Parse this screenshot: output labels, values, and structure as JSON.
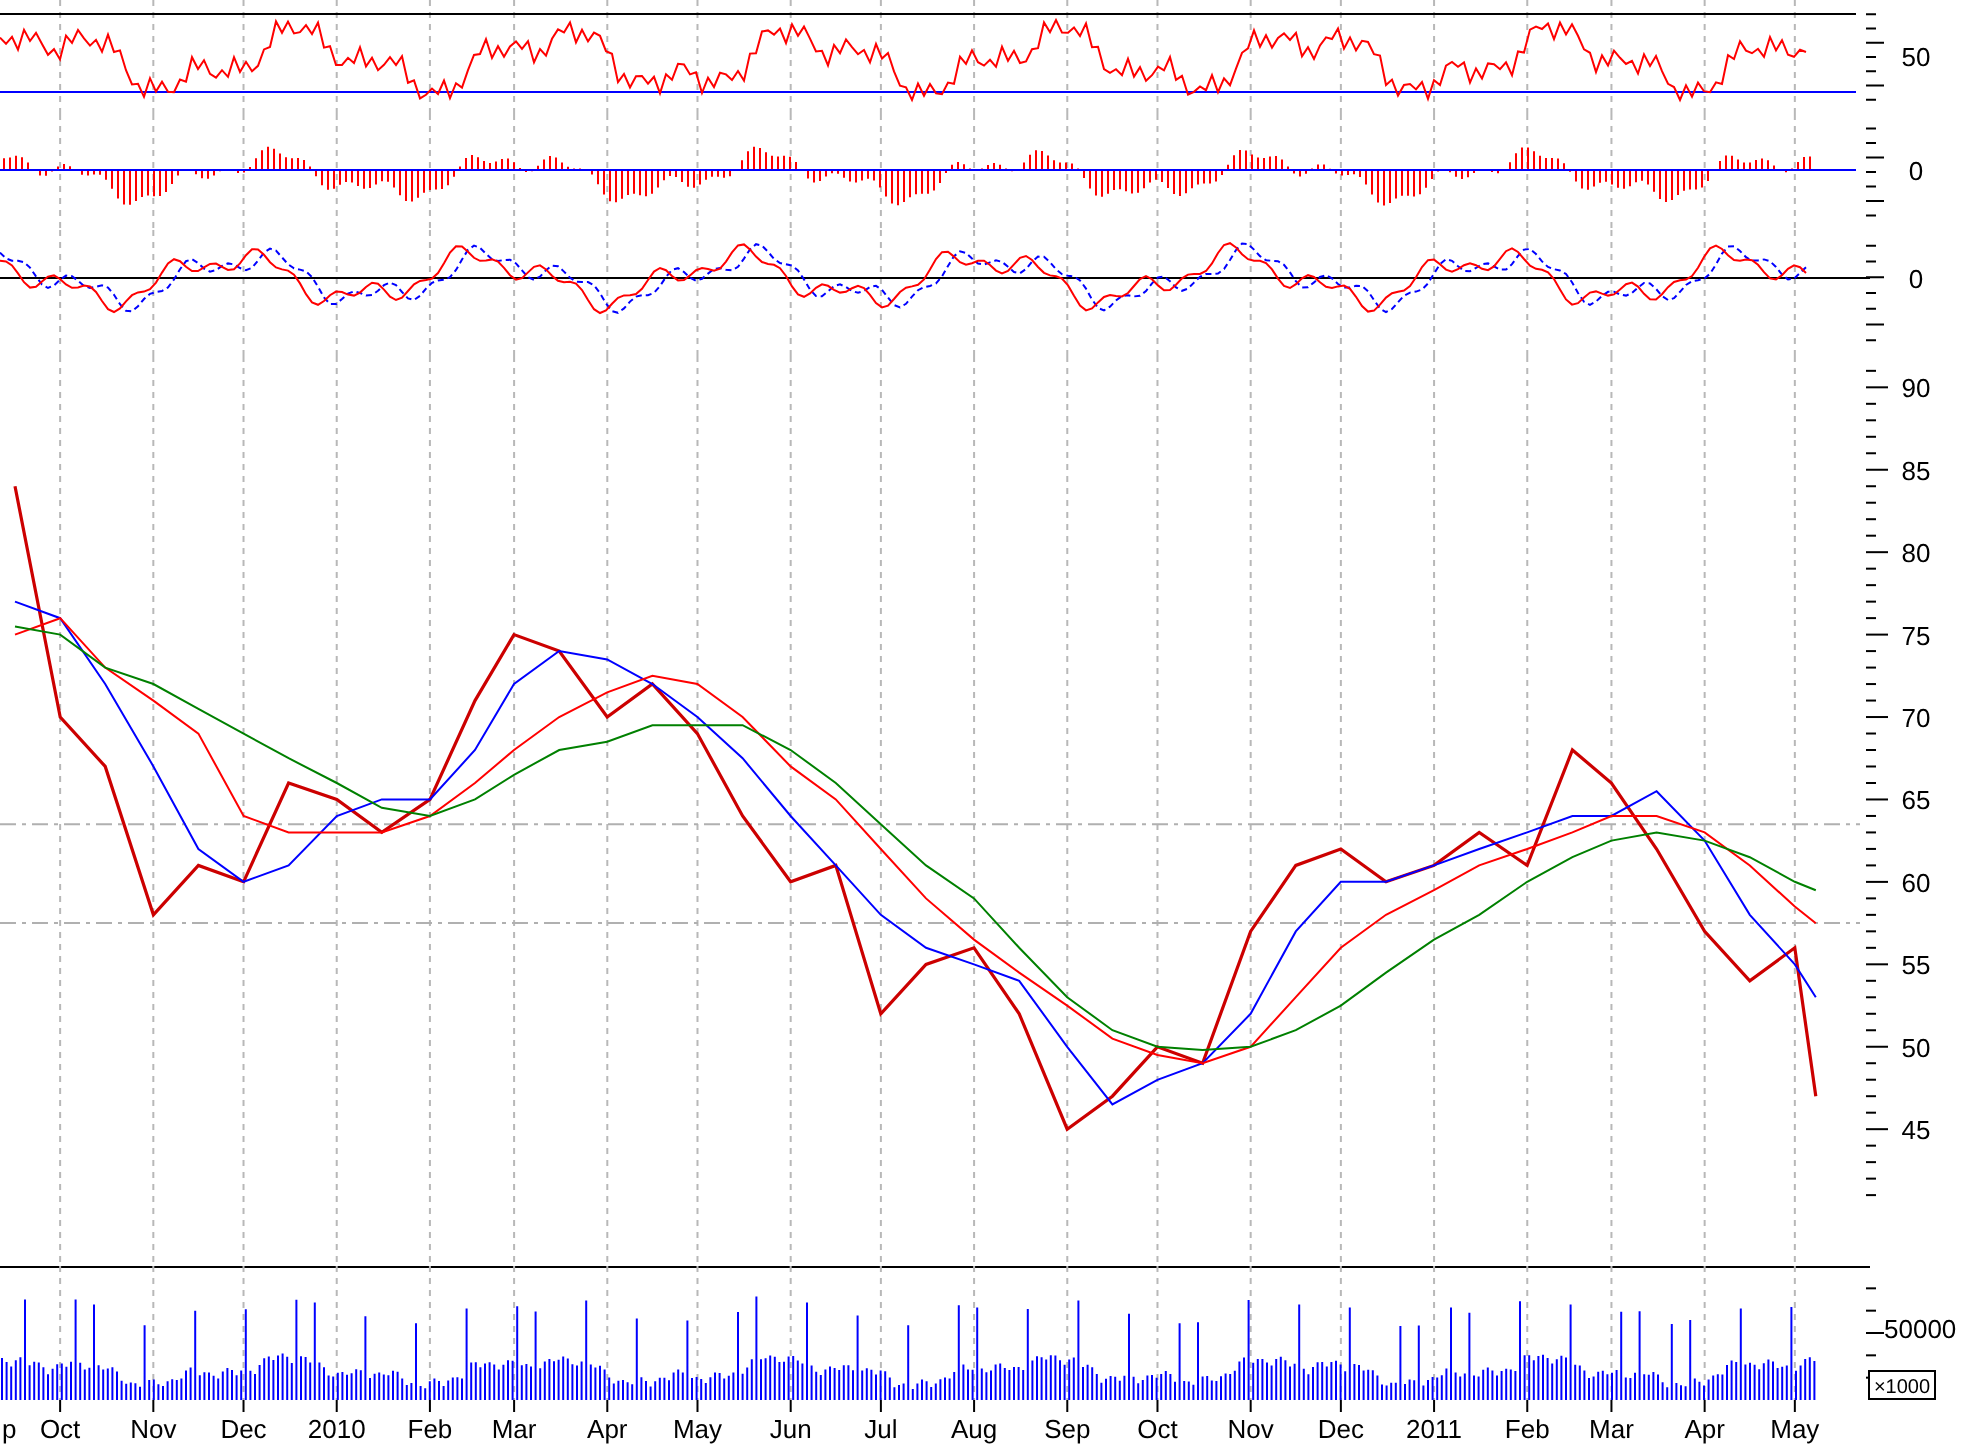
{
  "panes": [
    {
      "kind": "oscillator",
      "tick_label": "50"
    },
    {
      "kind": "histogram",
      "tick_label": "0"
    },
    {
      "kind": "crossover",
      "tick_label": "0"
    }
  ],
  "price": {
    "chart_data": {
      "type": "line",
      "x": [
        "2009-09-16",
        "2009-10-01",
        "2009-10-16",
        "2009-11-01",
        "2009-11-16",
        "2009-12-01",
        "2009-12-16",
        "2010-01-01",
        "2010-01-16",
        "2010-02-01",
        "2010-02-16",
        "2010-03-01",
        "2010-03-16",
        "2010-04-01",
        "2010-04-16",
        "2010-05-01",
        "2010-05-16",
        "2010-06-01",
        "2010-06-16",
        "2010-07-01",
        "2010-07-16",
        "2010-08-01",
        "2010-08-16",
        "2010-09-01",
        "2010-09-16",
        "2010-10-01",
        "2010-10-16",
        "2010-11-01",
        "2010-11-16",
        "2010-12-01",
        "2010-12-16",
        "2011-01-01",
        "2011-01-16",
        "2011-02-01",
        "2011-02-16",
        "2011-03-01",
        "2011-03-16",
        "2011-04-01",
        "2011-04-16",
        "2011-05-01",
        "2011-05-08"
      ],
      "series": [
        {
          "color": "#cc0000",
          "values": [
            84,
            70,
            67,
            58,
            61,
            60,
            66,
            65,
            63,
            65,
            71,
            75,
            74,
            70,
            72,
            69,
            64,
            60,
            61,
            52,
            55,
            56,
            52,
            45,
            47,
            50,
            49,
            57,
            61,
            62,
            60,
            61,
            63,
            61,
            68,
            66,
            62,
            57,
            54,
            56,
            47
          ]
        },
        {
          "color": "#0000ff",
          "values": [
            77,
            76,
            72,
            67,
            62,
            60,
            61,
            64,
            65,
            65,
            68,
            72,
            74,
            73.5,
            72,
            70,
            67.5,
            64,
            61,
            58,
            56,
            55,
            54,
            50,
            46.5,
            48,
            49,
            52,
            57,
            60,
            60,
            61,
            62,
            63,
            64,
            64,
            65.5,
            62.5,
            58,
            55,
            53
          ]
        },
        {
          "color": "#ff0000",
          "values": [
            75,
            76,
            73,
            71,
            69,
            64,
            63,
            63,
            63,
            64,
            66,
            68,
            70,
            71.5,
            72.5,
            72,
            70,
            67,
            65,
            62,
            59,
            56.5,
            54.5,
            52.5,
            50.5,
            49.5,
            49,
            50,
            53,
            56,
            58,
            59.5,
            61,
            62,
            63,
            64,
            64,
            63,
            61,
            58.5,
            57.5
          ]
        },
        {
          "color": "#008000",
          "values": [
            75.5,
            75,
            73,
            72,
            70.5,
            69,
            67.5,
            66,
            64.5,
            64,
            65,
            66.5,
            68,
            68.5,
            69.5,
            69.5,
            69.5,
            68,
            66,
            63.5,
            61,
            59,
            56,
            53,
            51,
            50,
            49.8,
            50,
            51,
            52.5,
            54.5,
            56.5,
            58,
            60,
            61.5,
            62.5,
            63,
            62.5,
            61.5,
            60,
            59.5
          ]
        }
      ],
      "xlim": [
        "2009-09-11",
        "2011-05-26"
      ],
      "ylim": [
        36.7,
        91.9
      ],
      "xticks": [
        {
          "value": "2009-10-01",
          "label": "Oct"
        },
        {
          "value": "2009-11-01",
          "label": "Nov"
        },
        {
          "value": "2009-12-01",
          "label": "Dec"
        },
        {
          "value": "2010-01-01",
          "label": "2010"
        },
        {
          "value": "2010-02-01",
          "label": "Feb"
        },
        {
          "value": "2010-03-01",
          "label": "Mar"
        },
        {
          "value": "2010-04-01",
          "label": "Apr"
        },
        {
          "value": "2010-05-01",
          "label": "May"
        },
        {
          "value": "2010-06-01",
          "label": "Jun"
        },
        {
          "value": "2010-07-01",
          "label": "Jul"
        },
        {
          "value": "2010-08-01",
          "label": "Aug"
        },
        {
          "value": "2010-09-01",
          "label": "Sep"
        },
        {
          "value": "2010-10-01",
          "label": "Oct"
        },
        {
          "value": "2010-11-01",
          "label": "Nov"
        },
        {
          "value": "2010-12-01",
          "label": "Dec"
        },
        {
          "value": "2011-01-01",
          "label": "2011"
        },
        {
          "value": "2011-02-01",
          "label": "Feb"
        },
        {
          "value": "2011-03-01",
          "label": "Mar"
        },
        {
          "value": "2011-04-01",
          "label": "Apr"
        },
        {
          "value": "2011-05-01",
          "label": "May"
        }
      ],
      "grid": true,
      "yticks": [
        {
          "value": 45,
          "label": "45"
        },
        {
          "value": 50,
          "label": "50"
        },
        {
          "value": 55,
          "label": "55"
        },
        {
          "value": 60,
          "label": "60"
        },
        {
          "value": 65,
          "label": "65"
        },
        {
          "value": 70,
          "label": "70"
        },
        {
          "value": 75,
          "label": "75"
        },
        {
          "value": 80,
          "label": "80"
        },
        {
          "value": 85,
          "label": "85"
        },
        {
          "value": 90,
          "label": "90"
        }
      ],
      "ref_lines": [
        {
          "axis": "y",
          "value": 63.5
        },
        {
          "axis": "y",
          "value": 57.5
        }
      ]
    }
  },
  "volume": {
    "tick_label": "50000",
    "unit": "×1000"
  },
  "x_axis": {
    "edge_label": "p"
  }
}
